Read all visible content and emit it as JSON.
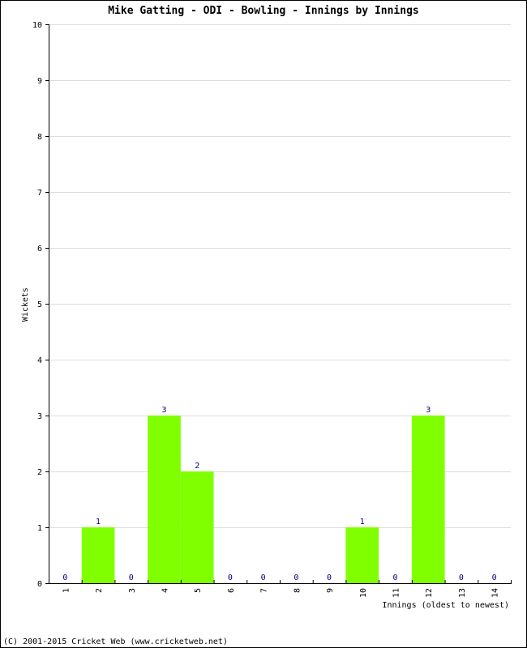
{
  "chart_data": {
    "type": "bar",
    "title": "Mike Gatting - ODI - Bowling - Innings by Innings",
    "xlabel": "Innings (oldest to newest)",
    "ylabel": "Wickets",
    "categories": [
      "1",
      "2",
      "3",
      "4",
      "5",
      "6",
      "7",
      "8",
      "9",
      "10",
      "11",
      "12",
      "13",
      "14"
    ],
    "values": [
      0,
      1,
      0,
      3,
      2,
      0,
      0,
      0,
      0,
      1,
      0,
      3,
      0,
      0
    ],
    "ylim": [
      0,
      10
    ],
    "yticks": [
      0,
      1,
      2,
      3,
      4,
      5,
      6,
      7,
      8,
      9,
      10
    ],
    "grid": true,
    "bar_color": "#80ff00",
    "label_color": "#000080",
    "grid_color": "#dddddd"
  },
  "footer": "(C) 2001-2015 Cricket Web (www.cricketweb.net)"
}
